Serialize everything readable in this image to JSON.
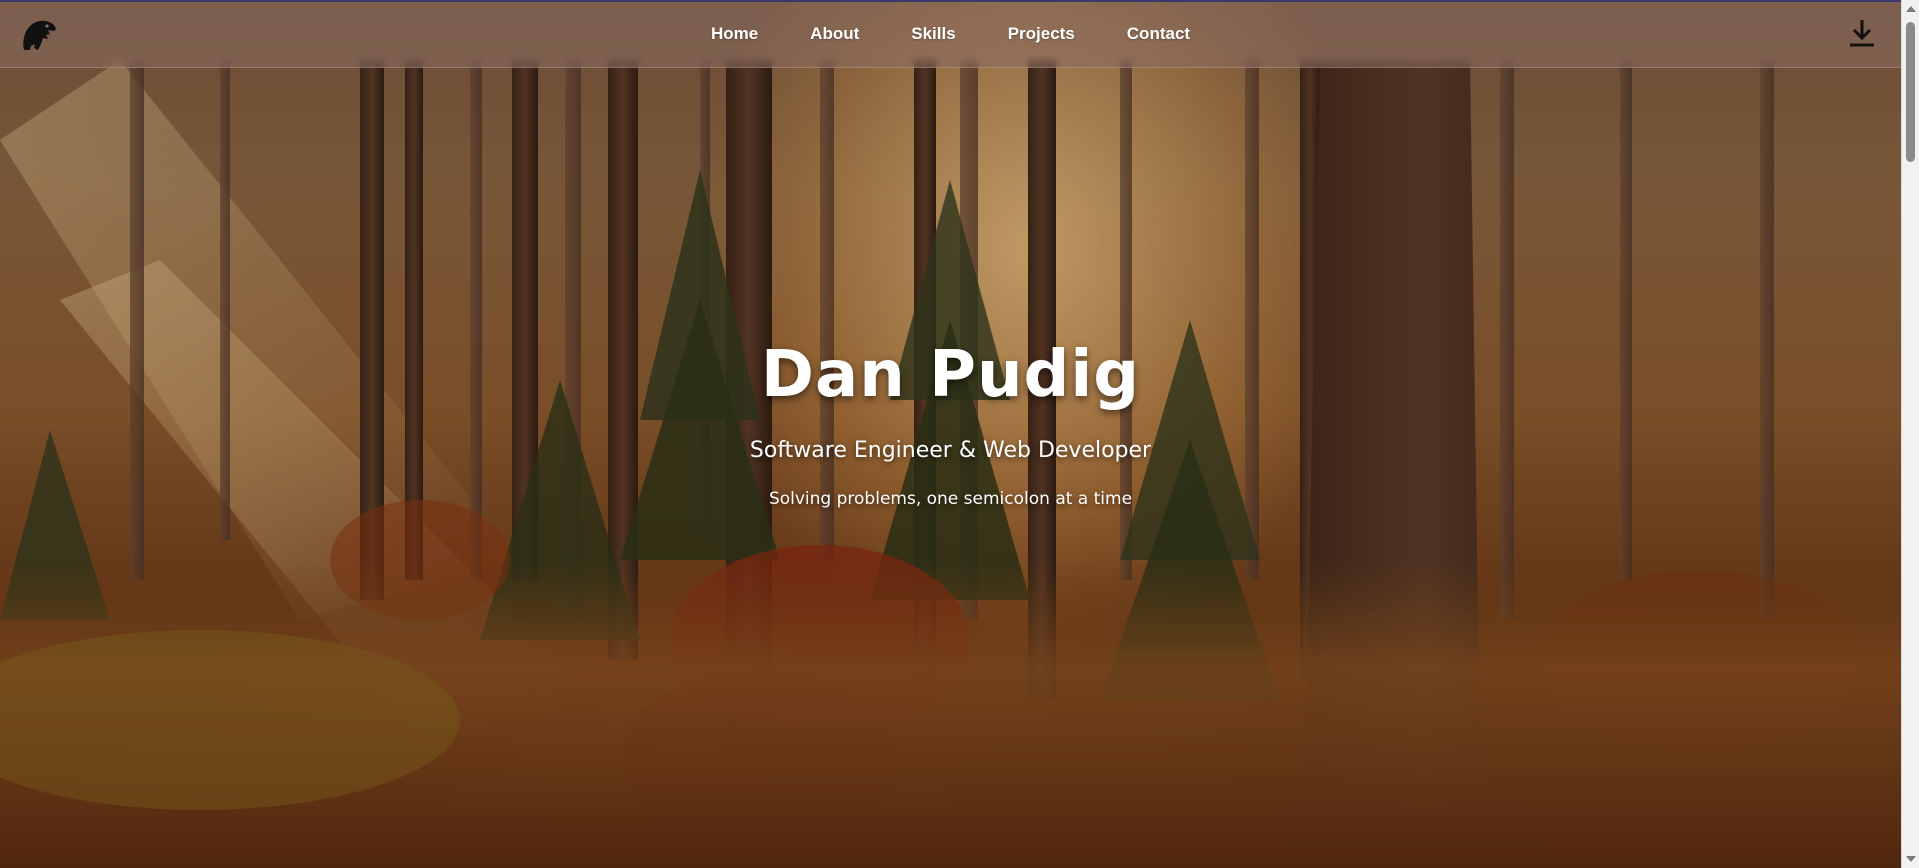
{
  "nav": {
    "logo_icon": "dinosaur-logo-icon",
    "links": [
      "Home",
      "About",
      "Skills",
      "Projects",
      "Contact"
    ],
    "download_icon": "download-icon"
  },
  "hero": {
    "name": "Dan Pudig",
    "title": "Software Engineer & Web Developer",
    "tagline": "Solving problems, one semicolon at a time"
  },
  "colors": {
    "nav_text": "#ffffff",
    "hero_text": "#ffffff",
    "scrollbar_track": "#f1f1f1",
    "scrollbar_thumb": "#8a8a8a"
  }
}
